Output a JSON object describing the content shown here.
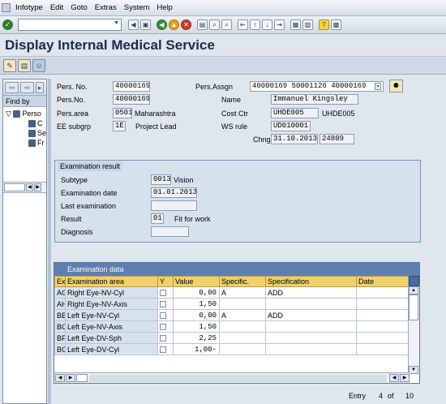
{
  "menu": {
    "items": [
      "Infotype",
      "Edit",
      "Goto",
      "Extras",
      "System",
      "Help"
    ]
  },
  "toolbar": {
    "command_value": "",
    "icons": [
      "enter-icon",
      "save-icon",
      "back-icon",
      "exit-icon",
      "cancel-icon",
      "print-icon",
      "find-icon",
      "find-next-icon",
      "first-page-icon",
      "previous-page-icon",
      "next-page-icon",
      "last-page-icon",
      "create-session-icon",
      "shortcut-icon",
      "help-icon",
      "customize-layout-icon"
    ]
  },
  "title": "Display Internal Medical Service",
  "navigator": {
    "find_by": "Find by",
    "tree": [
      "Perso",
      "C",
      "Se",
      "Fr"
    ]
  },
  "header": {
    "pers_no_label": "Pers. No.",
    "pers_no_value": "40000169",
    "pers_no2_label": "Pers.No.",
    "pers_no2_value": "40000169",
    "pers_area_label": "Pers.area",
    "pers_area_code": "0501",
    "pers_area_text": "Maharashtra",
    "ee_subgrp_label": "EE subgrp",
    "ee_subgrp_code": "1E",
    "ee_subgrp_text": "Project Lead",
    "pers_assgn_label": "Pers.Assgn",
    "pers_assgn_value": "40000169 50001126 40000169",
    "name_label": "Name",
    "name_value": "Immanuel Kingsley",
    "cost_ctr_label": "Cost Ctr",
    "cost_ctr_code": "UHDE005",
    "cost_ctr_text": "UHDE005",
    "ws_rule_label": "WS rule",
    "ws_rule_value": "UD010001",
    "chng_label": "Chng",
    "chng_date": "31.10.2013",
    "chng_user": "24809"
  },
  "exam_result": {
    "title": "Examination result",
    "subtype_label": "Subtype",
    "subtype_code": "0013",
    "subtype_text": "Vision",
    "exam_date_label": "Examination date",
    "exam_date_value": "01.01.2013",
    "last_exam_label": "Last examination",
    "last_exam_value": "",
    "result_label": "Result",
    "result_code": "01",
    "result_text": "Fit for work",
    "diagnosis_label": "Diagnosis",
    "diagnosis_value": ""
  },
  "exam_data": {
    "title": "Examination data",
    "columns": [
      "Ex",
      "Examination area",
      "Y",
      "Value",
      "Specific.",
      "Specification",
      "Date"
    ],
    "rows": [
      {
        "ex": "AG",
        "area": "Right Eye-NV-Cyl",
        "value": "0,00",
        "specific": "A",
        "specification": "ADD",
        "date": ""
      },
      {
        "ex": "AH",
        "area": "Right Eye-NV-Axis",
        "value": "1,50",
        "specific": "",
        "specification": "",
        "date": ""
      },
      {
        "ex": "BB",
        "area": "Left Eye-NV-Cyl",
        "value": "0,00",
        "specific": "A",
        "specification": "ADD",
        "date": ""
      },
      {
        "ex": "BC",
        "area": "Left Eye-NV-Axis",
        "value": "1,50",
        "specific": "",
        "specification": "",
        "date": ""
      },
      {
        "ex": "BF",
        "area": "Left Eye-DV-Sph",
        "value": "2,25",
        "specific": "",
        "specification": "",
        "date": ""
      },
      {
        "ex": "BG",
        "area": "Left Eye-DV-Cyl",
        "value": "1,00-",
        "specific": "",
        "specification": "",
        "date": ""
      }
    ]
  },
  "footer": {
    "entry_label": "Entry",
    "entry_current": "4",
    "of_label": "of",
    "entry_total": "10"
  }
}
